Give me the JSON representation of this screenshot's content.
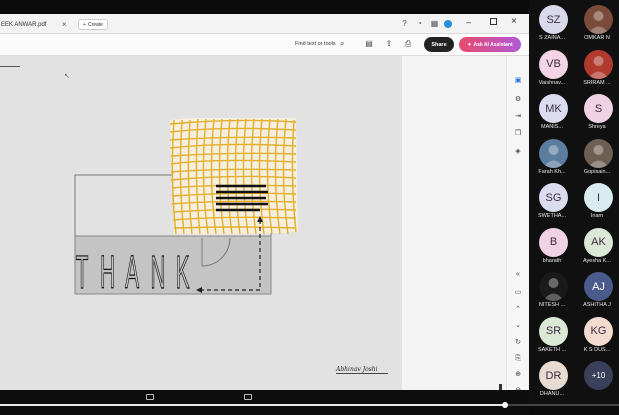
{
  "window": {
    "tab_title": "EEK ANWAR.pdf",
    "create_label": "Create",
    "find_label": "Find text or tools",
    "share_label": "Share",
    "ai_label": "Ask AI Assistant"
  },
  "drawing": {
    "letters": [
      "T",
      "H",
      "A",
      "N",
      "K"
    ],
    "signature": "Abhinav Joshi"
  },
  "participants": [
    {
      "initials": "SZ",
      "name": "S ZAINA...",
      "color": "#d9d9ec"
    },
    {
      "initials": "",
      "name": "OMKAR N",
      "color": "#7a4b3a",
      "photo": true
    },
    {
      "initials": "VB",
      "name": "Vaishnav...",
      "color": "#f2d4e4"
    },
    {
      "initials": "",
      "name": "SRIRAM ...",
      "color": "#b03a2e",
      "photo": true
    },
    {
      "initials": "MK",
      "name": "MANIS...",
      "color": "#dcdcf0"
    },
    {
      "initials": "S",
      "name": "Shreya",
      "color": "#f0d2e4"
    },
    {
      "initials": "",
      "name": "Farah Kh...",
      "color": "#5a7da0",
      "photo": true
    },
    {
      "initials": "",
      "name": "Gopisain...",
      "color": "#6d5f52",
      "photo": true
    },
    {
      "initials": "SG",
      "name": "SWETHA...",
      "color": "#dcdcf0"
    },
    {
      "initials": "I",
      "name": "Inam",
      "color": "#d9ecef"
    },
    {
      "initials": "B",
      "name": "bharath",
      "color": "#f0d2e4"
    },
    {
      "initials": "AK",
      "name": "Ayesha K...",
      "color": "#dbe8d5"
    },
    {
      "initials": "",
      "name": "NITESH ...",
      "color": "#1a1a1a",
      "photo": true
    },
    {
      "initials": "AJ",
      "name": "ASHITHA J",
      "color": "#4a5a8a",
      "photo": true
    },
    {
      "initials": "SR",
      "name": "SAKETH ...",
      "color": "#dbe8d5"
    },
    {
      "initials": "KG",
      "name": "K S DUS...",
      "color": "#f3dccf"
    },
    {
      "initials": "DR",
      "name": "DHANU...",
      "color": "#e8dcd2"
    },
    {
      "initials": "+10",
      "name": "",
      "color": "#3a3f5a"
    }
  ]
}
